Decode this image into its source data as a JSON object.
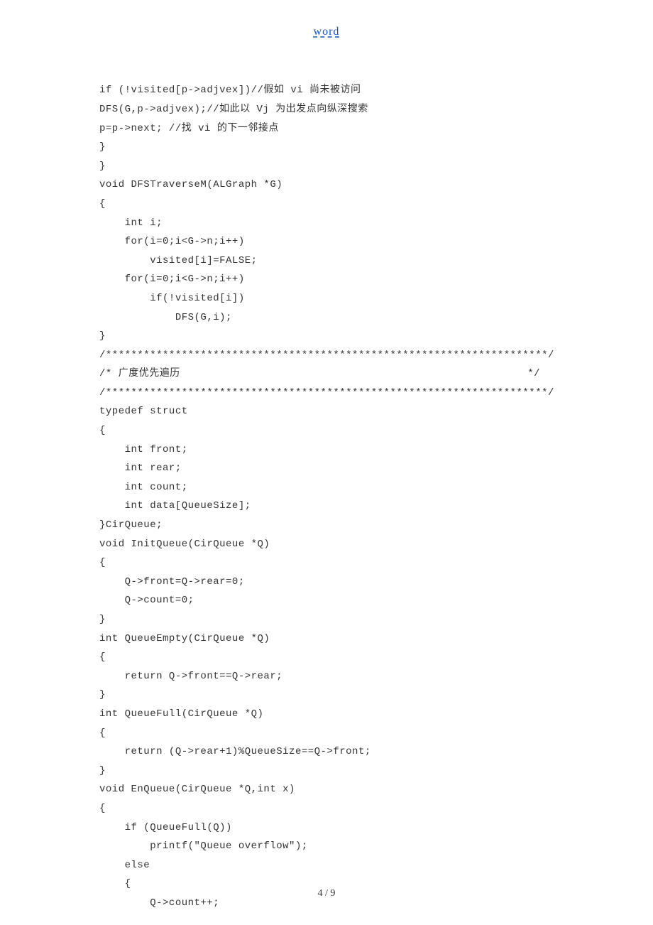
{
  "header": {
    "title": "word"
  },
  "code": {
    "lines": [
      "if (!visited[p->adjvex])//假如 vi 尚未被访问",
      "DFS(G,p->adjvex);//如此以 Vj 为出发点向纵深搜索",
      "p=p->next; //找 vi 的下一邻接点",
      "}",
      "}",
      "void DFSTraverseM(ALGraph *G)",
      "{",
      "    int i;",
      "    for(i=0;i<G->n;i++)",
      "        visited[i]=FALSE;",
      "    for(i=0;i<G->n;i++)",
      "        if(!visited[i])",
      "            DFS(G,i);",
      "}",
      "/**********************************************************************/",
      "/* 广度优先遍历                                                       */",
      "/**********************************************************************/",
      "typedef struct",
      "{",
      "    int front;",
      "    int rear;",
      "    int count;",
      "    int data[QueueSize];",
      "}CirQueue;",
      "void InitQueue(CirQueue *Q)",
      "{",
      "    Q->front=Q->rear=0;",
      "    Q->count=0;",
      "}",
      "int QueueEmpty(CirQueue *Q)",
      "{",
      "    return Q->front==Q->rear;",
      "}",
      "int QueueFull(CirQueue *Q)",
      "{",
      "    return (Q->rear+1)%QueueSize==Q->front;",
      "}",
      "void EnQueue(CirQueue *Q,int x)",
      "{",
      "    if (QueueFull(Q))",
      "        printf(\"Queue overflow\");",
      "    else",
      "    {",
      "        Q->count++;"
    ]
  },
  "footer": {
    "page_number": "4 / 9"
  }
}
